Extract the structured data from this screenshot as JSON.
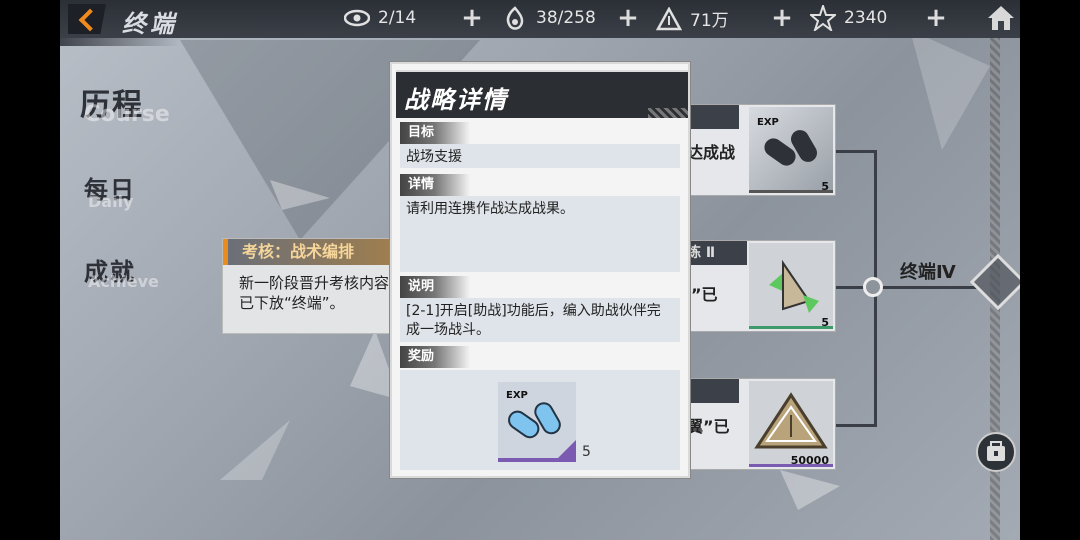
{
  "header": {
    "title": "终端",
    "resources": [
      {
        "icon": "eye-icon",
        "value": "2/14"
      },
      {
        "icon": "stamina-icon",
        "value": "38/258"
      },
      {
        "icon": "coin-icon",
        "value": "71万"
      },
      {
        "icon": "crystal-icon",
        "value": "2340"
      }
    ]
  },
  "nav": {
    "items": [
      {
        "cn": "历程",
        "en": "Course"
      },
      {
        "cn": "每日",
        "en": "Daily"
      },
      {
        "cn": "成就",
        "en": "Achieve"
      }
    ]
  },
  "task": {
    "header": "考核：战术编排",
    "body": "新一阶段晋升考核内容\n已下放“终端”。"
  },
  "rewards": [
    {
      "label": "达成战",
      "count": "5"
    },
    {
      "label": "”已",
      "tag": "练 Ⅱ",
      "count": "5"
    },
    {
      "label": "翼”已",
      "count": "50000"
    }
  ],
  "term_label": "终端Ⅳ",
  "modal": {
    "title": "战略详情",
    "sections": {
      "goal_label": "目标",
      "goal_text": "战场支援",
      "detail_label": "详情",
      "detail_text": "请利用连携作战达成战果。",
      "note_label": "说明",
      "note_text": "[2-1]开启[助战]功能后，编入助战伙伴完成一场战斗。",
      "reward_label": "奖励",
      "reward_count": "5",
      "reward_exp": "EXP"
    }
  },
  "colors": {
    "accent": "#e98b1e",
    "panel_dark": "#2b2e33",
    "purple": "#7b5ab2",
    "green": "#3f9a6a"
  }
}
